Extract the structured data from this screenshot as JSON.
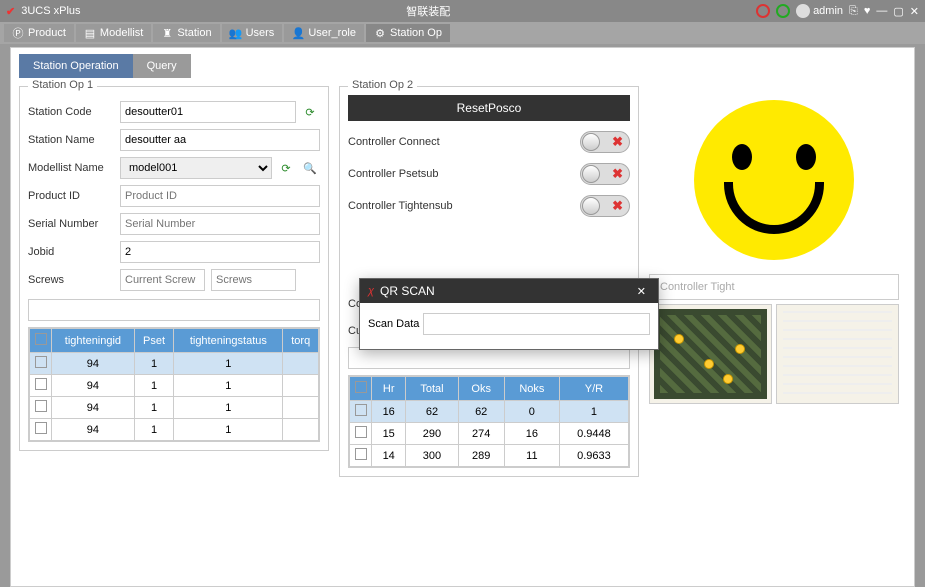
{
  "titlebar": {
    "appname": "3UCS xPlus",
    "center": "智联装配",
    "user": "admin"
  },
  "tabs": [
    {
      "label": "Product"
    },
    {
      "label": "Modellist"
    },
    {
      "label": "Station"
    },
    {
      "label": "Users"
    },
    {
      "label": "User_role"
    },
    {
      "label": "Station Op"
    }
  ],
  "subtabs": {
    "operation": "Station Operation",
    "query": "Query"
  },
  "op1": {
    "legend": "Station Op 1",
    "station_code_label": "Station Code",
    "station_code": "desoutter01",
    "station_name_label": "Station Name",
    "station_name": "desoutter aa",
    "modellist_label": "Modellist Name",
    "modellist": "model001",
    "product_id_label": "Product ID",
    "product_id_ph": "Product ID",
    "serial_label": "Serial Number",
    "serial_ph": "Serial Number",
    "jobid_label": "Jobid",
    "jobid": "2",
    "screws_label": "Screws",
    "screws_ph1": "Current Screw",
    "screws_ph2": "Screws"
  },
  "op2": {
    "legend": "Station Op 2",
    "reset": "ResetPosco",
    "controller_connect": "Controller Connect",
    "controller_psetsub": "Controller Psetsub",
    "controller_tightensub": "Controller Tightensub",
    "controller_posco_conn": "Controller Posco Conn",
    "current_program": "Current Program"
  },
  "side": {
    "controller_tight": "Controller Tight"
  },
  "table1": {
    "headers": [
      "tighteningid",
      "Pset",
      "tighteningstatus",
      "torq"
    ],
    "rows": [
      {
        "id": "94",
        "pset": "1",
        "status": "1"
      },
      {
        "id": "94",
        "pset": "1",
        "status": "1"
      },
      {
        "id": "94",
        "pset": "1",
        "status": "1"
      },
      {
        "id": "94",
        "pset": "1",
        "status": "1"
      }
    ]
  },
  "table2": {
    "headers": [
      "Hr",
      "Total",
      "Oks",
      "Noks",
      "Y/R"
    ],
    "rows": [
      {
        "hr": "16",
        "total": "62",
        "oks": "62",
        "noks": "0",
        "yr": "1"
      },
      {
        "hr": "15",
        "total": "290",
        "oks": "274",
        "noks": "16",
        "yr": "0.9448"
      },
      {
        "hr": "14",
        "total": "300",
        "oks": "289",
        "noks": "11",
        "yr": "0.9633"
      }
    ]
  },
  "modal": {
    "title": "QR SCAN",
    "scan_label": "Scan Data"
  }
}
